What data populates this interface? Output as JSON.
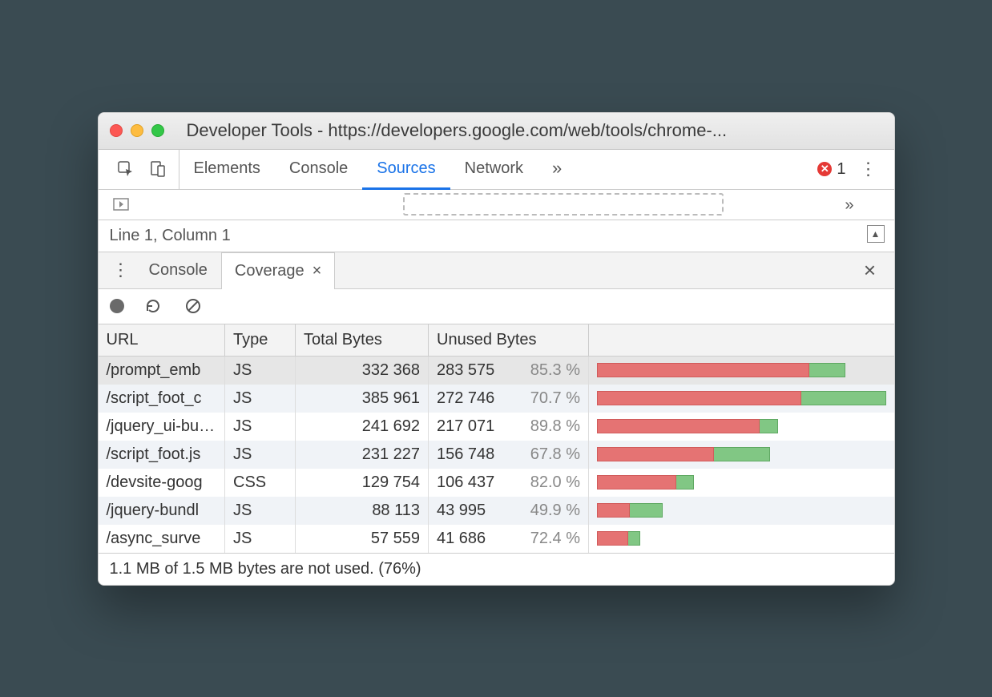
{
  "window": {
    "title": "Developer Tools - https://developers.google.com/web/tools/chrome-..."
  },
  "tabs": {
    "items": [
      {
        "label": "Elements",
        "active": false
      },
      {
        "label": "Console",
        "active": false
      },
      {
        "label": "Sources",
        "active": true
      },
      {
        "label": "Network",
        "active": false
      }
    ],
    "overflow_glyph": "»",
    "error_count": "1"
  },
  "editor_status": {
    "cursor": "Line 1, Column 1"
  },
  "drawer": {
    "tabs": {
      "console": "Console",
      "coverage": "Coverage"
    },
    "close_glyph": "×"
  },
  "coverage_table": {
    "headers": {
      "url": "URL",
      "type": "Type",
      "total": "Total Bytes",
      "unused": "Unused Bytes"
    },
    "max_bytes": 385961,
    "rows": [
      {
        "url": "/prompt_emb",
        "type": "JS",
        "total": "332 368",
        "total_num": 332368,
        "unused": "283 575",
        "unused_num": 283575,
        "pct": "85.3 %",
        "selected": true
      },
      {
        "url": "/script_foot_c",
        "type": "JS",
        "total": "385 961",
        "total_num": 385961,
        "unused": "272 746",
        "unused_num": 272746,
        "pct": "70.7 %",
        "selected": false
      },
      {
        "url": "/jquery_ui-bu…",
        "type": "JS",
        "total": "241 692",
        "total_num": 241692,
        "unused": "217 071",
        "unused_num": 217071,
        "pct": "89.8 %",
        "selected": false
      },
      {
        "url": "/script_foot.js",
        "type": "JS",
        "total": "231 227",
        "total_num": 231227,
        "unused": "156 748",
        "unused_num": 156748,
        "pct": "67.8 %",
        "selected": false
      },
      {
        "url": "/devsite-goog",
        "type": "CSS",
        "total": "129 754",
        "total_num": 129754,
        "unused": "106 437",
        "unused_num": 106437,
        "pct": "82.0 %",
        "selected": false
      },
      {
        "url": "/jquery-bundl",
        "type": "JS",
        "total": "88 113",
        "total_num": 88113,
        "unused": "43 995",
        "unused_num": 43995,
        "pct": "49.9 %",
        "selected": false
      },
      {
        "url": "/async_surve",
        "type": "JS",
        "total": "57 559",
        "total_num": 57559,
        "unused": "41 686",
        "unused_num": 41686,
        "pct": "72.4 %",
        "selected": false
      }
    ]
  },
  "statusbar": {
    "text": "1.1 MB of 1.5 MB bytes are not used. (76%)"
  }
}
